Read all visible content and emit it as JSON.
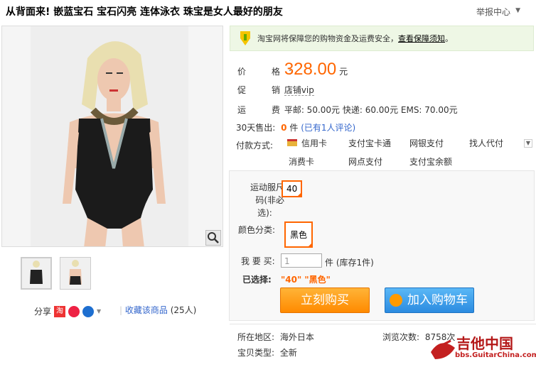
{
  "title": "从背面来! 嵌蓝宝石 宝石闪亮 连体泳衣 珠宝是女人最好的朋友",
  "report": "举报中心",
  "guarantee": {
    "text": "淘宝网将保障您的购物资金及运费安全，",
    "link": "查看保障须知",
    "tail": "。"
  },
  "price": {
    "label": "价　格:",
    "value": "328.00",
    "unit": "元"
  },
  "promo": {
    "label": "促　销:",
    "value": "店铺vip"
  },
  "shipping": {
    "label": "运　费:",
    "value": "平邮: 50.00元 快递: 60.00元 EMS: 70.00元"
  },
  "sales": {
    "label": "30天售出:",
    "count": "0",
    "unit": "件",
    "reviews": "(已有1人评论)"
  },
  "payment": {
    "label": "付款方式:",
    "methods": [
      "信用卡",
      "支付宝卡通",
      "网银支付",
      "找人代付",
      "消费卡",
      "网点支付",
      "支付宝余额"
    ]
  },
  "options": {
    "size_label_1": "运动服尺",
    "size_label_2": "码(非必",
    "size_label_3": "选):",
    "size_value": "40",
    "color_label": "颜色分类:",
    "color_value": "黑色",
    "qty_label": "我 要 买:",
    "qty_value": "1",
    "qty_unit": "件 (库存1件)",
    "selected_label": "已选择:",
    "selected_value": "\"40\" \"黑色\""
  },
  "buttons": {
    "buy": "立刻购买",
    "cart": "加入购物车"
  },
  "location": {
    "label": "所在地区:",
    "value": "海外日本"
  },
  "condition": {
    "label": "宝贝类型:",
    "value": "全新"
  },
  "views": {
    "label": "浏览次数:",
    "value": "8758次"
  },
  "share": {
    "label": "分享"
  },
  "favorite": {
    "label": "收藏该商品",
    "count": "(25人)"
  },
  "watermark": {
    "main": "吉他中国",
    "sub": "bbs.GuitarChina.com"
  }
}
